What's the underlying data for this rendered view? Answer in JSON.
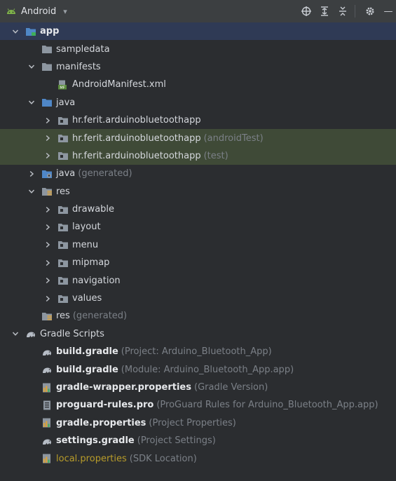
{
  "toolbar": {
    "title": "Android",
    "caret": "▾",
    "minimize": "—"
  },
  "tree": [
    {
      "label": "app",
      "hint": "",
      "indent": 0,
      "chevron": "down",
      "icon": "module-folder-icon",
      "style": "bold",
      "row": "sel"
    },
    {
      "label": "sampledata",
      "hint": "",
      "indent": 1,
      "chevron": "none",
      "icon": "folder-icon",
      "style": "",
      "row": ""
    },
    {
      "label": "manifests",
      "hint": "",
      "indent": 1,
      "chevron": "down",
      "icon": "folder-icon",
      "style": "",
      "row": ""
    },
    {
      "label": "AndroidManifest.xml",
      "hint": "",
      "indent": 2,
      "chevron": "none",
      "icon": "manifest-file-icon",
      "style": "",
      "row": ""
    },
    {
      "label": "java",
      "hint": "",
      "indent": 1,
      "chevron": "down",
      "icon": "source-folder-icon",
      "style": "",
      "row": ""
    },
    {
      "label": "hr.ferit.arduinobluetoothapp",
      "hint": "",
      "indent": 2,
      "chevron": "right",
      "icon": "package-icon",
      "style": "",
      "row": ""
    },
    {
      "label": "hr.ferit.arduinobluetoothapp",
      "hint": "(androidTest)",
      "indent": 2,
      "chevron": "right",
      "icon": "package-icon",
      "style": "",
      "row": "hl"
    },
    {
      "label": "hr.ferit.arduinobluetoothapp",
      "hint": "(test)",
      "indent": 2,
      "chevron": "right",
      "icon": "package-icon",
      "style": "",
      "row": "hl"
    },
    {
      "label": "java",
      "hint": "(generated)",
      "indent": 1,
      "chevron": "right",
      "icon": "generated-folder-icon",
      "style": "",
      "row": ""
    },
    {
      "label": "res",
      "hint": "",
      "indent": 1,
      "chevron": "down",
      "icon": "resources-folder-icon",
      "style": "",
      "row": ""
    },
    {
      "label": "drawable",
      "hint": "",
      "indent": 2,
      "chevron": "right",
      "icon": "package-icon",
      "style": "",
      "row": ""
    },
    {
      "label": "layout",
      "hint": "",
      "indent": 2,
      "chevron": "right",
      "icon": "package-icon",
      "style": "",
      "row": ""
    },
    {
      "label": "menu",
      "hint": "",
      "indent": 2,
      "chevron": "right",
      "icon": "package-icon",
      "style": "",
      "row": ""
    },
    {
      "label": "mipmap",
      "hint": "",
      "indent": 2,
      "chevron": "right",
      "icon": "package-icon",
      "style": "",
      "row": ""
    },
    {
      "label": "navigation",
      "hint": "",
      "indent": 2,
      "chevron": "right",
      "icon": "package-icon",
      "style": "",
      "row": ""
    },
    {
      "label": "values",
      "hint": "",
      "indent": 2,
      "chevron": "right",
      "icon": "package-icon",
      "style": "",
      "row": ""
    },
    {
      "label": "res",
      "hint": "(generated)",
      "indent": 1,
      "chevron": "none",
      "icon": "resources-folder-icon",
      "style": "",
      "row": ""
    },
    {
      "label": "Gradle Scripts",
      "hint": "",
      "indent": 0,
      "chevron": "down",
      "icon": "gradle-elephant-icon",
      "style": "",
      "row": ""
    },
    {
      "label": "build.gradle",
      "hint": "(Project: Arduino_Bluetooth_App)",
      "indent": 1,
      "chevron": "none",
      "icon": "gradle-elephant-icon",
      "style": "bold",
      "row": ""
    },
    {
      "label": "build.gradle",
      "hint": "(Module: Arduino_Bluetooth_App.app)",
      "indent": 1,
      "chevron": "none",
      "icon": "gradle-elephant-icon",
      "style": "bold",
      "row": ""
    },
    {
      "label": "gradle-wrapper.properties",
      "hint": "(Gradle Version)",
      "indent": 1,
      "chevron": "none",
      "icon": "properties-file-icon",
      "style": "bold",
      "row": ""
    },
    {
      "label": "proguard-rules.pro",
      "hint": "(ProGuard Rules for Arduino_Bluetooth_App.app)",
      "indent": 1,
      "chevron": "none",
      "icon": "text-file-icon",
      "style": "bold",
      "row": ""
    },
    {
      "label": "gradle.properties",
      "hint": "(Project Properties)",
      "indent": 1,
      "chevron": "none",
      "icon": "properties-file-icon",
      "style": "bold",
      "row": ""
    },
    {
      "label": "settings.gradle",
      "hint": "(Project Settings)",
      "indent": 1,
      "chevron": "none",
      "icon": "gradle-elephant-icon",
      "style": "bold",
      "row": ""
    },
    {
      "label": "local.properties",
      "hint": "(SDK Location)",
      "indent": 1,
      "chevron": "none",
      "icon": "properties-file-icon",
      "style": "mod",
      "row": ""
    }
  ]
}
